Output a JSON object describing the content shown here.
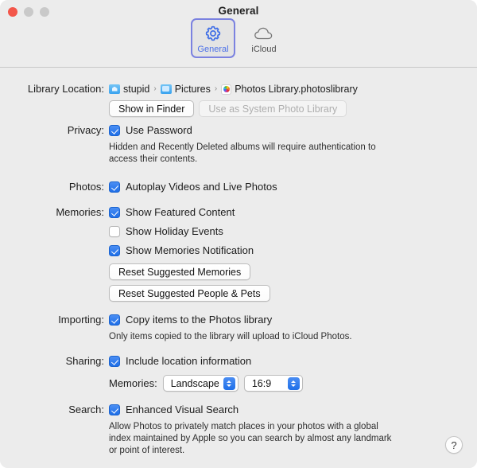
{
  "window": {
    "title": "General",
    "traffic_lights": [
      "close",
      "minimize",
      "zoom"
    ]
  },
  "toolbar": {
    "tabs": [
      {
        "label": "General",
        "icon": "gear-icon",
        "selected": true
      },
      {
        "label": "iCloud",
        "icon": "cloud-icon",
        "selected": false
      }
    ],
    "selected_color": "#4a6fe8",
    "selection_border": "#7b82e0"
  },
  "sections": {
    "library_location": {
      "label": "Library Location:",
      "breadcrumb": [
        {
          "name": "stupid",
          "icon": "home-folder-icon"
        },
        {
          "name": "Pictures",
          "icon": "folder-icon"
        },
        {
          "name": "Photos Library.photoslibrary",
          "icon": "photos-library-icon"
        }
      ],
      "separator": "›",
      "buttons": [
        {
          "label": "Show in Finder",
          "enabled": true
        },
        {
          "label": "Use as System Photo Library",
          "enabled": false
        }
      ]
    },
    "privacy": {
      "label": "Privacy:",
      "checkbox": {
        "label": "Use Password",
        "checked": true
      },
      "hint": "Hidden and Recently Deleted albums will require authentication to access their contents."
    },
    "photos": {
      "label": "Photos:",
      "checkbox": {
        "label": "Autoplay Videos and Live Photos",
        "checked": true
      }
    },
    "memories": {
      "label": "Memories:",
      "checkboxes": [
        {
          "label": "Show Featured Content",
          "checked": true
        },
        {
          "label": "Show Holiday Events",
          "checked": false
        },
        {
          "label": "Show Memories Notification",
          "checked": true
        }
      ],
      "buttons": [
        {
          "label": "Reset Suggested Memories"
        },
        {
          "label": "Reset Suggested People & Pets"
        }
      ]
    },
    "importing": {
      "label": "Importing:",
      "checkbox": {
        "label": "Copy items to the Photos library",
        "checked": true
      },
      "hint": "Only items copied to the library will upload to iCloud Photos."
    },
    "sharing": {
      "label": "Sharing:",
      "checkbox": {
        "label": "Include location information",
        "checked": true
      },
      "memories_label": "Memories:",
      "orientation_popup": {
        "value": "Landscape"
      },
      "aspect_popup": {
        "value": "16:9"
      }
    },
    "search": {
      "label": "Search:",
      "checkbox": {
        "label": "Enhanced Visual Search",
        "checked": true
      },
      "hint": "Allow Photos to privately match places in your photos with a global index maintained by Apple so you can search by almost any landmark or point of interest."
    }
  },
  "help_button": {
    "glyph": "?"
  },
  "colors": {
    "accent": "#1f6fe8",
    "window_background": "#ececec",
    "text": "#1c1c1c"
  }
}
